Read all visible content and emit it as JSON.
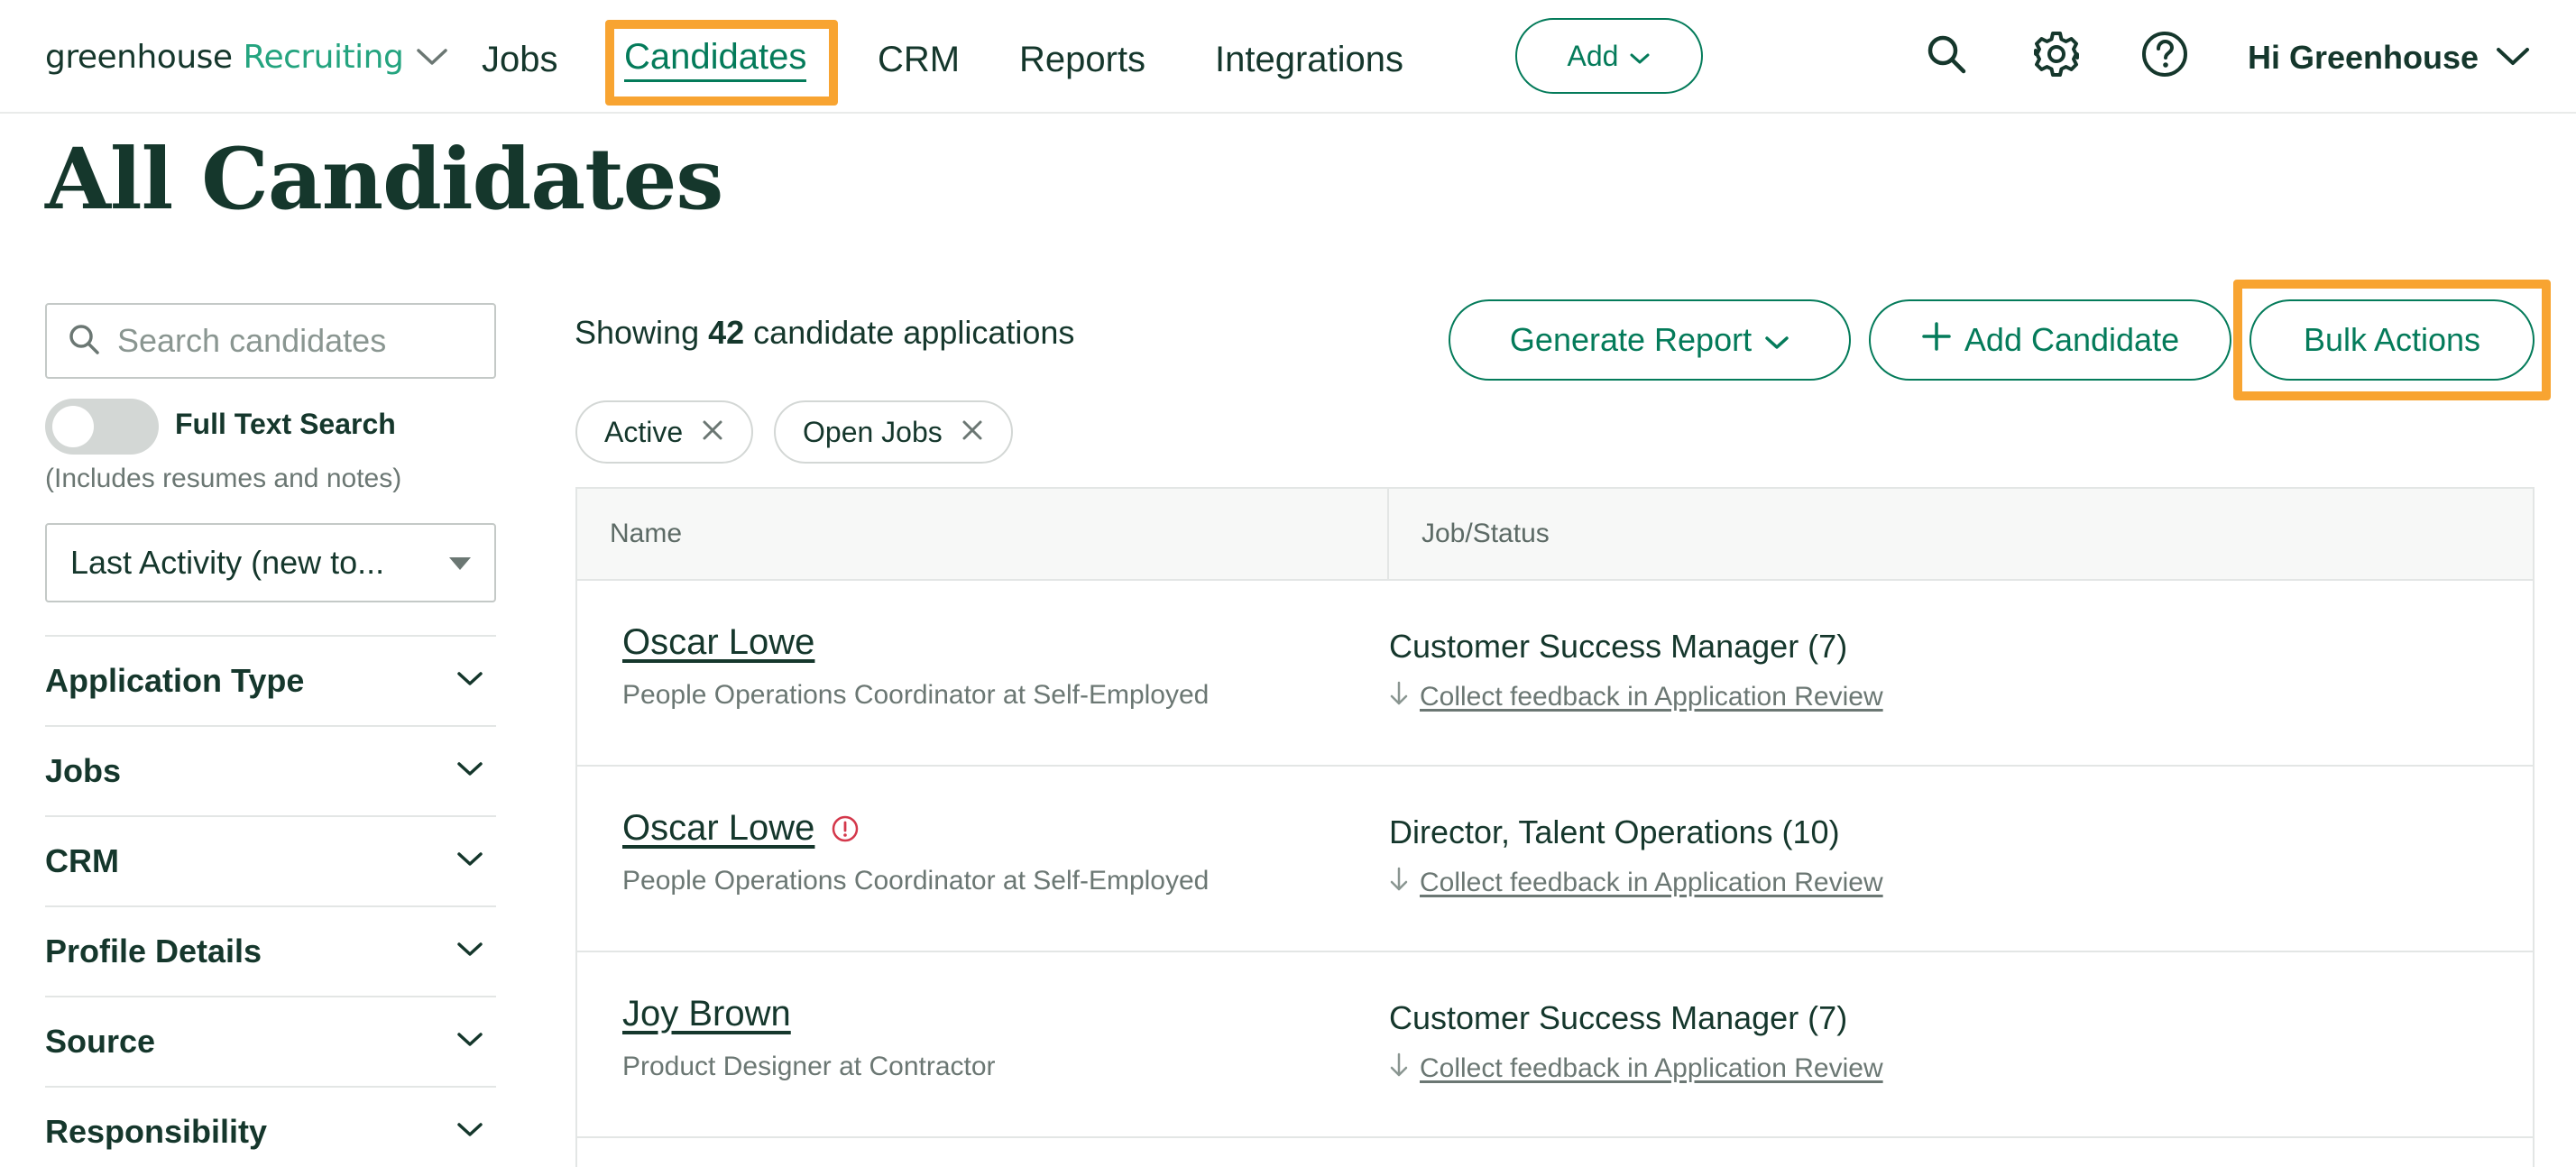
{
  "nav": {
    "logo_main": "greenhouse",
    "logo_sub": "Recruiting",
    "items": [
      {
        "label": "Jobs"
      },
      {
        "label": "Candidates"
      },
      {
        "label": "CRM"
      },
      {
        "label": "Reports"
      },
      {
        "label": "Integrations"
      }
    ],
    "active_item": "Candidates",
    "add_label": "Add",
    "greeting": "Hi Greenhouse",
    "icons": [
      "search-icon",
      "gear-icon",
      "help-icon",
      "chevron-down-icon"
    ]
  },
  "page": {
    "title": "All Candidates"
  },
  "sidebar": {
    "search_placeholder": "Search candidates",
    "full_text_label": "Full Text Search",
    "full_text_note": "(Includes resumes and notes)",
    "full_text_enabled": false,
    "sort_value": "Last Activity (new to...",
    "filters": [
      {
        "label": "Application Type"
      },
      {
        "label": "Jobs"
      },
      {
        "label": "CRM"
      },
      {
        "label": "Profile Details"
      },
      {
        "label": "Source"
      },
      {
        "label": "Responsibility"
      }
    ]
  },
  "main": {
    "showing_prefix": "Showing",
    "showing_count": "42",
    "showing_suffix": "candidate applications",
    "generate_report_label": "Generate Report",
    "add_candidate_label": "Add Candidate",
    "bulk_actions_label": "Bulk Actions",
    "chips": [
      {
        "label": "Active"
      },
      {
        "label": "Open Jobs"
      }
    ],
    "columns": [
      "Name",
      "Job/Status"
    ],
    "rows": [
      {
        "name": "Oscar Lowe",
        "subtitle": "People Operations Coordinator at Self-Employed",
        "job": "Customer Success Manager (7)",
        "action": "Collect feedback in Application Review",
        "alert": false
      },
      {
        "name": "Oscar Lowe",
        "subtitle": "People Operations Coordinator at Self-Employed",
        "job": "Director, Talent Operations (10)",
        "action": "Collect feedback in Application Review",
        "alert": true
      },
      {
        "name": "Joy Brown",
        "subtitle": "Product Designer at Contractor",
        "job": "Customer Success Manager (7)",
        "action": "Collect feedback in Application Review",
        "alert": false
      }
    ]
  },
  "colors": {
    "brand_green": "#047b5a",
    "logo_green": "#24a47f",
    "text_dark": "#15372c",
    "highlight_orange": "#f8a431",
    "alert_red": "#d4384b"
  }
}
